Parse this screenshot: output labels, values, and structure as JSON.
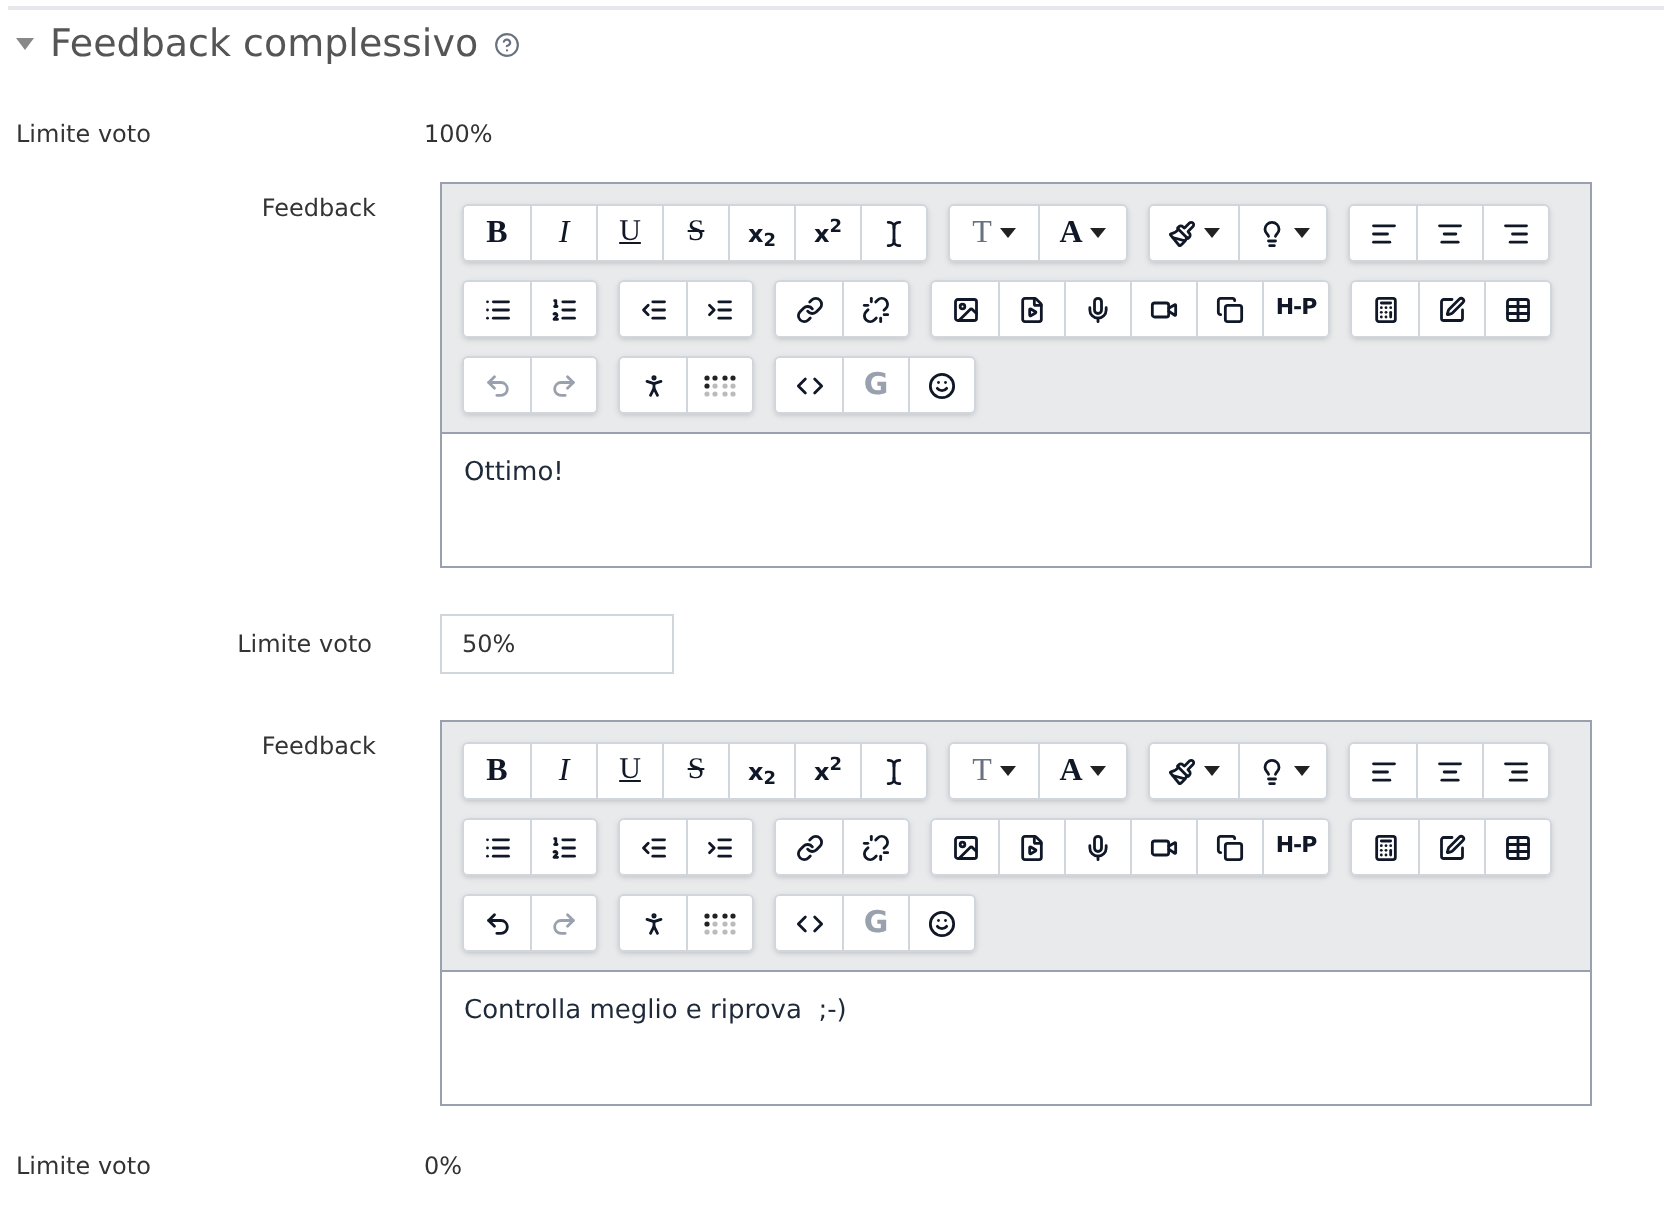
{
  "section": {
    "title": "Feedback complessivo",
    "expanded": true
  },
  "rows": [
    {
      "kind": "static",
      "label": "Limite voto",
      "value": "100%"
    },
    {
      "kind": "editor",
      "label": "Feedback",
      "text": "Ottimo!",
      "toolbar": [
        [
          [
            {
              "kind": "bold",
              "label": "B",
              "disabled": false
            },
            {
              "kind": "italic",
              "label": "I",
              "disabled": false
            },
            {
              "kind": "underline",
              "label": "U",
              "disabled": false
            },
            {
              "kind": "strike",
              "label": "S",
              "disabled": false
            },
            {
              "kind": "subscript",
              "label": "x$_{2}$",
              "disabled": false
            },
            {
              "kind": "superscript",
              "label": "x$^{2}$",
              "disabled": false
            },
            {
              "kind": "clear",
              "disabled": false
            }
          ],
          [
            {
              "kind": "fontsize",
              "label": "T",
              "disabled": false
            },
            {
              "kind": "fontcolor",
              "label": "A",
              "disabled": false
            }
          ],
          [
            {
              "kind": "brush",
              "disabled": false
            },
            {
              "kind": "bulb",
              "disabled": false
            }
          ],
          [
            {
              "kind": "alignleft",
              "disabled": false
            },
            {
              "kind": "aligncenter",
              "disabled": false
            },
            {
              "kind": "alignright",
              "disabled": false
            }
          ]
        ],
        [
          [
            {
              "kind": "bullets",
              "disabled": false
            },
            {
              "kind": "numbers",
              "disabled": false
            }
          ],
          [
            {
              "kind": "outdent",
              "disabled": false
            },
            {
              "kind": "indent",
              "disabled": false
            }
          ],
          [
            {
              "kind": "link",
              "disabled": false
            },
            {
              "kind": "unlink",
              "disabled": false
            }
          ],
          [
            {
              "kind": "image",
              "disabled": false
            },
            {
              "kind": "media",
              "disabled": false
            },
            {
              "kind": "mic",
              "disabled": false
            },
            {
              "kind": "video",
              "disabled": false
            },
            {
              "kind": "files",
              "disabled": false
            },
            {
              "kind": "h5p",
              "label": "H-P",
              "disabled": false
            }
          ],
          [
            {
              "kind": "calculator",
              "disabled": false
            },
            {
              "kind": "edit",
              "disabled": false
            },
            {
              "kind": "table",
              "disabled": false
            }
          ]
        ],
        [
          [
            {
              "kind": "undo",
              "disabled": true
            },
            {
              "kind": "redo",
              "disabled": true
            }
          ],
          [
            {
              "kind": "accessibility",
              "disabled": false
            },
            {
              "kind": "braille",
              "disabled": false
            }
          ],
          [
            {
              "kind": "code",
              "disabled": false
            },
            {
              "kind": "g",
              "label": "G",
              "disabled": true
            },
            {
              "kind": "emoji",
              "disabled": false
            }
          ]
        ]
      ]
    },
    {
      "kind": "input",
      "label": "Limite voto",
      "value": "50%"
    },
    {
      "kind": "editor",
      "label": "Feedback",
      "text": "Controlla meglio e riprova  ;-)",
      "toolbar": [
        [
          [
            {
              "kind": "bold",
              "label": "B",
              "disabled": false
            },
            {
              "kind": "italic",
              "label": "I",
              "disabled": false
            },
            {
              "kind": "underline",
              "label": "U",
              "disabled": false
            },
            {
              "kind": "strike",
              "label": "S",
              "disabled": false
            },
            {
              "kind": "subscript",
              "label": "x$_{2}$",
              "disabled": false
            },
            {
              "kind": "superscript",
              "label": "x$^{2}$",
              "disabled": false
            },
            {
              "kind": "clear",
              "disabled": false
            }
          ],
          [
            {
              "kind": "fontsize",
              "label": "T",
              "disabled": false
            },
            {
              "kind": "fontcolor",
              "label": "A",
              "disabled": false
            }
          ],
          [
            {
              "kind": "brush",
              "disabled": false
            },
            {
              "kind": "bulb",
              "disabled": false
            }
          ],
          [
            {
              "kind": "alignleft",
              "disabled": false
            },
            {
              "kind": "aligncenter",
              "disabled": false
            },
            {
              "kind": "alignright",
              "disabled": false
            }
          ]
        ],
        [
          [
            {
              "kind": "bullets",
              "disabled": false
            },
            {
              "kind": "numbers",
              "disabled": false
            }
          ],
          [
            {
              "kind": "outdent",
              "disabled": false
            },
            {
              "kind": "indent",
              "disabled": false
            }
          ],
          [
            {
              "kind": "link",
              "disabled": false
            },
            {
              "kind": "unlink",
              "disabled": false
            }
          ],
          [
            {
              "kind": "image",
              "disabled": false
            },
            {
              "kind": "media",
              "disabled": false
            },
            {
              "kind": "mic",
              "disabled": false
            },
            {
              "kind": "video",
              "disabled": false
            },
            {
              "kind": "files",
              "disabled": false
            },
            {
              "kind": "h5p",
              "label": "H-P",
              "disabled": false
            }
          ],
          [
            {
              "kind": "calculator",
              "disabled": false
            },
            {
              "kind": "edit",
              "disabled": false
            },
            {
              "kind": "table",
              "disabled": false
            }
          ]
        ],
        [
          [
            {
              "kind": "undo",
              "disabled": false
            },
            {
              "kind": "redo",
              "disabled": true
            }
          ],
          [
            {
              "kind": "accessibility",
              "disabled": false
            },
            {
              "kind": "braille",
              "disabled": false
            }
          ],
          [
            {
              "kind": "code",
              "disabled": false
            },
            {
              "kind": "g",
              "label": "G",
              "disabled": true
            },
            {
              "kind": "emoji",
              "disabled": false
            }
          ]
        ]
      ]
    },
    {
      "kind": "static",
      "label": "Limite voto",
      "value": "0%"
    }
  ]
}
